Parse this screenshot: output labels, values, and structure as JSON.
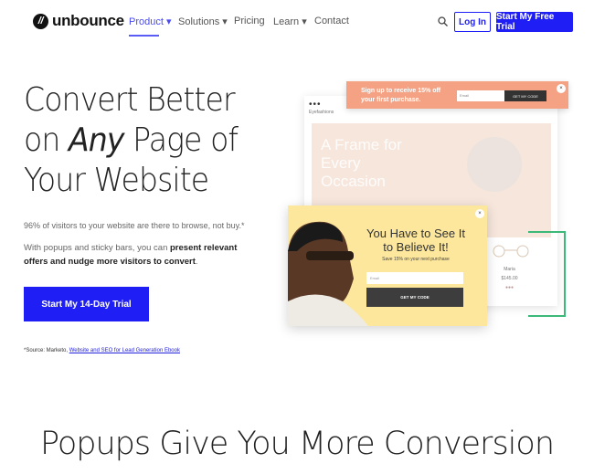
{
  "nav": {
    "logo": "unbounce",
    "logo_mark": "//",
    "items": [
      {
        "label": "Product ▾"
      },
      {
        "label": "Solutions ▾"
      },
      {
        "label": "Pricing"
      },
      {
        "label": "Learn ▾"
      },
      {
        "label": "Contact"
      }
    ],
    "search_icon": "search-icon",
    "login": "Log In",
    "trial": "Start My Free Trial"
  },
  "hero": {
    "line1": "Convert Better",
    "line2a": "on ",
    "line2b": "Any",
    "line2c": " Page of",
    "line3": "Your Website",
    "stat": "96% of visitors to your website are there to browse, not buy.*",
    "body_a": "With popups and sticky bars, you can ",
    "body_b": "present relevant offers and nudge more visitors to convert",
    "body_c": ".",
    "cta": "Start My 14-Day Trial",
    "source_prefix": "*Source: Marketo, ",
    "source_link": "Website and SEO for Lead Generation Ebook"
  },
  "mockup": {
    "dots": "•••",
    "brand": "Eyefashions",
    "frame_title": "A Frame for Every Occasion",
    "product_name": "Maria",
    "product_price": "$145.00",
    "bar": {
      "text": "Sign up to receive 15% off your first purchase.",
      "email": "Email",
      "button": "GET MY CODE",
      "close": "×"
    },
    "popup": {
      "title": "You Have to See It to Believe It!",
      "sub": "Save 15% on your next purchase",
      "email": "Email",
      "button": "GET MY CODE",
      "close": "×"
    }
  },
  "section": {
    "title": "Popups Give You More Conversion"
  },
  "colors": {
    "accent": "#1f1ff5",
    "bar": "#f4a283",
    "popup": "#fde79c",
    "green": "#3cb879"
  }
}
